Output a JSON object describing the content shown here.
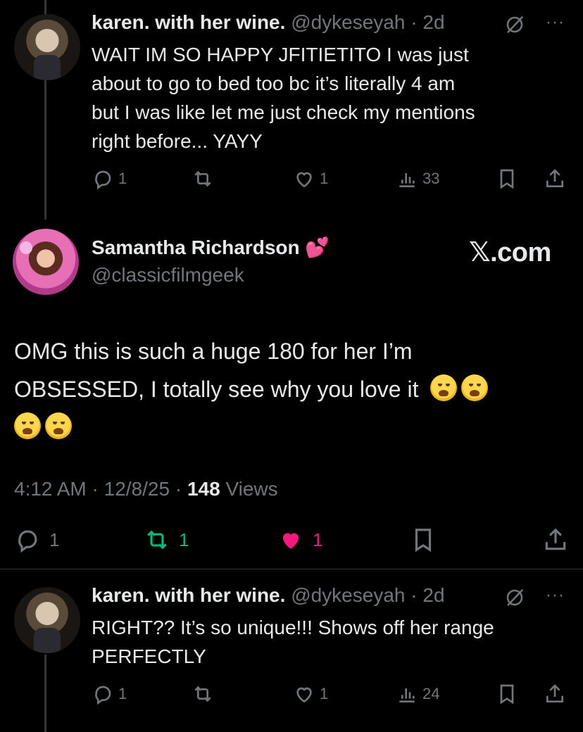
{
  "reply1": {
    "name": "karen. with her wine.",
    "handle": "@dykeseyah",
    "sep": "·",
    "time": "2d",
    "more": "···",
    "text_lines": [
      "WAIT IM SO HAPPY JFITIETITO I was just",
      "about to go to bed too bc it’s literally 4 am",
      "but I was like let me just check my mentions",
      "right before... YAYY"
    ],
    "replies": "1",
    "likes": "1",
    "views": "33"
  },
  "main": {
    "name": "Samantha Richardson",
    "name_emoji": "💕",
    "handle": "@classicfilmgeek",
    "source": "𝕏.com",
    "text_line1": "OMG this is such a huge 180 for her I’m",
    "text_line2": "OBSESSED, I totally see why you love it",
    "time": "4:12 AM",
    "sep1": "·",
    "date": "12/8/25",
    "sep2": "·",
    "views": "148",
    "views_label": "Views",
    "replies": "1",
    "reposts": "1",
    "likes": "1"
  },
  "reply2": {
    "name": "karen. with her wine.",
    "handle": "@dykeseyah",
    "sep": "·",
    "time": "2d",
    "more": "···",
    "text_lines": [
      "RIGHT?? It’s so unique!!! Shows off her range",
      "PERFECTLY"
    ],
    "replies": "1",
    "likes": "1",
    "views": "24"
  },
  "colors": {
    "background": "#000000",
    "text": "#e7e9ea",
    "muted": "#71767b",
    "repost_active": "#00ba7c",
    "like_active": "#f91880"
  },
  "icons": [
    "reply-icon",
    "repost-icon",
    "like-icon",
    "views-icon",
    "bookmark-icon",
    "share-icon",
    "grok-icon"
  ]
}
